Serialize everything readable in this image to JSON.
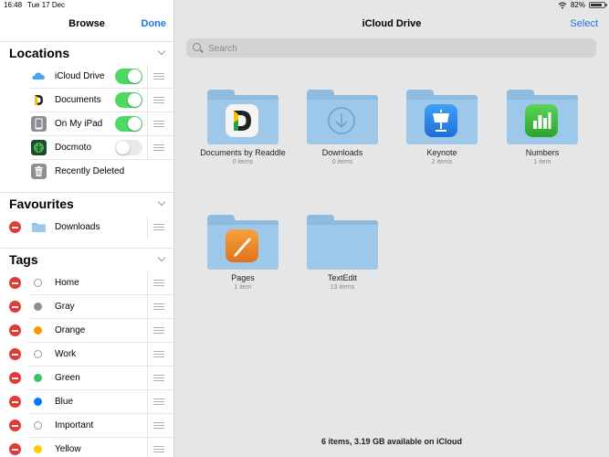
{
  "statusbar": {
    "time": "16:48",
    "date": "Tue 17 Dec",
    "battery": "82%",
    "battery_level": 0.82
  },
  "sidebar": {
    "title": "Browse",
    "done_label": "Done",
    "sections": {
      "locations": {
        "label": "Locations"
      },
      "favourites": {
        "label": "Favourites"
      },
      "tags": {
        "label": "Tags"
      }
    },
    "locations": [
      {
        "label": "iCloud Drive",
        "icon": "icloud-icon",
        "enabled": true
      },
      {
        "label": "Documents",
        "icon": "documents-app-icon",
        "enabled": true
      },
      {
        "label": "On My iPad",
        "icon": "ipad-icon",
        "enabled": true
      },
      {
        "label": "Docmoto",
        "icon": "docmoto-icon",
        "enabled": false
      },
      {
        "label": "Recently Deleted",
        "icon": "trash-icon"
      }
    ],
    "favourites": [
      {
        "label": "Downloads",
        "icon": "folder-icon"
      }
    ],
    "tags": [
      {
        "label": "Home",
        "color": ""
      },
      {
        "label": "Gray",
        "color": "#8e8e93"
      },
      {
        "label": "Orange",
        "color": "#ff9500"
      },
      {
        "label": "Work",
        "color": ""
      },
      {
        "label": "Green",
        "color": "#34c759"
      },
      {
        "label": "Blue",
        "color": "#007aff"
      },
      {
        "label": "Important",
        "color": ""
      },
      {
        "label": "Yellow",
        "color": "#ffcc00"
      }
    ]
  },
  "main": {
    "title": "iCloud Drive",
    "select_label": "Select",
    "search_placeholder": "Search",
    "items": [
      {
        "name": "Documents by Readdle",
        "count": "0 items",
        "app": "documents-app-icon"
      },
      {
        "name": "Downloads",
        "count": "0 items",
        "app": "download-arrow-icon"
      },
      {
        "name": "Keynote",
        "count": "2 items",
        "app": "keynote-icon"
      },
      {
        "name": "Numbers",
        "count": "1 item",
        "app": "numbers-icon"
      },
      {
        "name": "Pages",
        "count": "1 item",
        "app": "pages-icon"
      },
      {
        "name": "TextEdit",
        "count": "13 items",
        "app": ""
      }
    ],
    "footer": "6 items, 3.19 GB available on iCloud"
  },
  "colors": {
    "accent": "#1a73e8",
    "toggle_on": "#4cd964",
    "delete": "#e53935",
    "folder": "#9ec8ea"
  }
}
